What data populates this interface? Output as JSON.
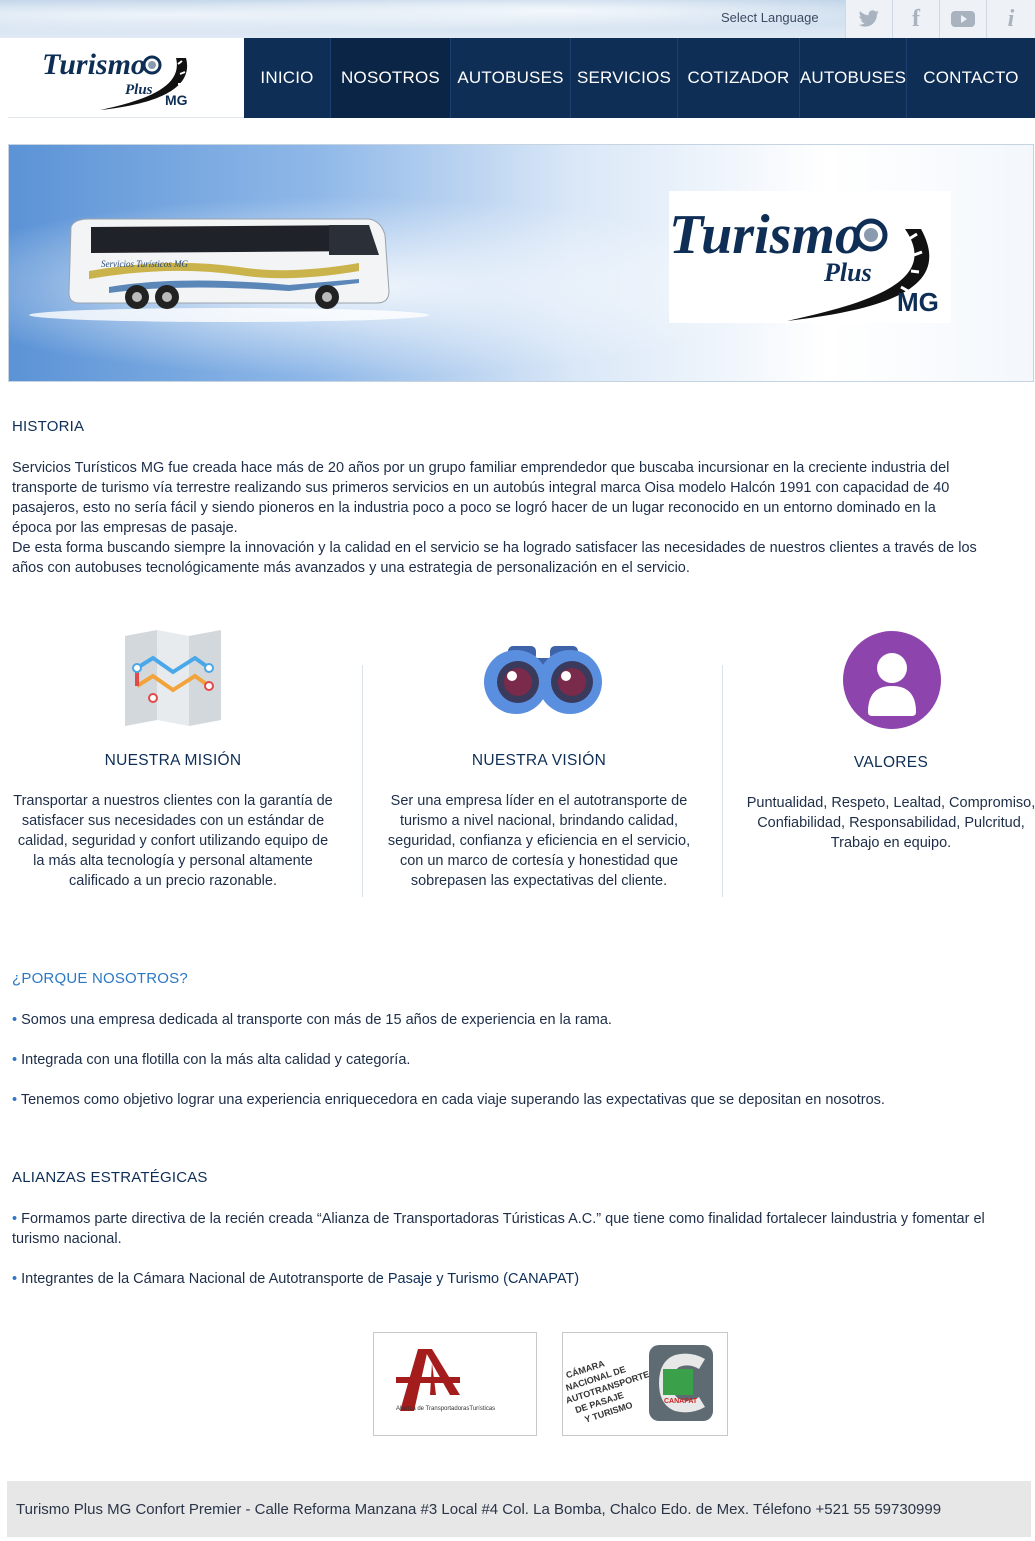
{
  "topbar": {
    "language_label": "Select Language",
    "social": [
      {
        "icon": "twitter-icon",
        "glyph": "🐦"
      },
      {
        "icon": "facebook-icon",
        "glyph": "f"
      },
      {
        "icon": "youtube-icon",
        "glyph": "▶"
      },
      {
        "icon": "info-icon",
        "glyph": "i"
      }
    ]
  },
  "brand": {
    "logo_word": "Turismo",
    "logo_sub": "Plus",
    "logo_mg": "MG"
  },
  "nav": {
    "items": [
      "INICIO",
      "NOSOTROS",
      "AUTOBUSES",
      "SERVICIOS",
      "COTIZADOR",
      "AUTOBUSES",
      "CONTACTO"
    ],
    "active": "NOSOTROS"
  },
  "hero": {
    "bus_lettering": "Servicios Turísticos MG"
  },
  "historia": {
    "title": "HISTORIA",
    "p1": "Servicios Turísticos MG fue creada hace más de 20 años por un grupo familiar emprendedor que buscaba incursionar en la creciente industria del transporte de turismo vía terrestre realizando sus primeros servicios en un autobús integral marca Oisa modelo Halcón 1991 con capacidad de 40 pasajeros, esto no sería fácil y siendo pioneros en la industria poco a poco se logró hacer de un lugar reconocido en un entorno dominado en la época por las empresas de pasaje.",
    "p2": "De esta forma buscando siempre la innovación y la calidad en el servicio se ha logrado satisfacer las necesidades de nuestros clientes a través de los años con autobuses tecnológicamente más avanzados y una estrategia de personalización en el servicio."
  },
  "columns": [
    {
      "icon": "map-icon",
      "title": "NUESTRA MISIÓN",
      "text": "Transportar a nuestros clientes con la garantía de satisfacer sus necesidades con un estándar de calidad, seguridad y confort utilizando equipo de la más alta tecnología y personal altamente calificado a un precio razonable."
    },
    {
      "icon": "binoculars-icon",
      "title": "NUESTRA VISIÓN",
      "text": "Ser una empresa líder en el autotransporte de turismo a nivel nacional, brindando calidad, seguridad, confianza y eficiencia en el servicio, con un marco de cortesía y honestidad que sobrepasen las expectativas del cliente."
    },
    {
      "icon": "user-icon",
      "title": "VALORES",
      "text": "Puntualidad, Respeto, Lealtad, Compromiso, Confiabilidad, Responsabilidad, Pulcritud, Trabajo en equipo."
    }
  ],
  "porque": {
    "title": "¿PORQUE NOSOTROS?",
    "items": [
      "Somos una empresa dedicada al transporte con más de 15 años de experiencia en la rama.",
      "Integrada con una flotilla con la más alta calidad y categoría.",
      "Tenemos como objetivo lograr una experiencia enriquecedora en cada viaje superando las expectativas que se depositan en nosotros."
    ]
  },
  "alianzas": {
    "title": "ALIANZAS ESTRATÉGICAS",
    "item1": "Formamos parte directiva de la recién creada “Alianza de Transportadoras Túristicas A.C.” que tiene como finalidad fortalecer laindustria y fomentar el turismo nacional.",
    "item2_a": "Integrantes de la Cámara Nacional de Autotransporte d",
    "item2_b": "e Pasaje y Turismo (CANAPAT)"
  },
  "partners": {
    "alianza_caption": "Alianza de TransportadorasTurísticas",
    "canapat_text": "CÁMARA NACIONAL DE AUTOTRANSPORTE DE PASAJE Y TURISMO",
    "canapat_badge": "CANAPAT"
  },
  "footer": {
    "text": "Turismo Plus MG Confort Premier - Calle Reforma Manzana #3 Local #4 Col. La Bomba, Chalco Edo. de Mex. Télefono +521 55 59730999"
  },
  "colors": {
    "navy": "#0e2e55",
    "accent_blue": "#2b78c4",
    "purple": "#8e44ad"
  }
}
